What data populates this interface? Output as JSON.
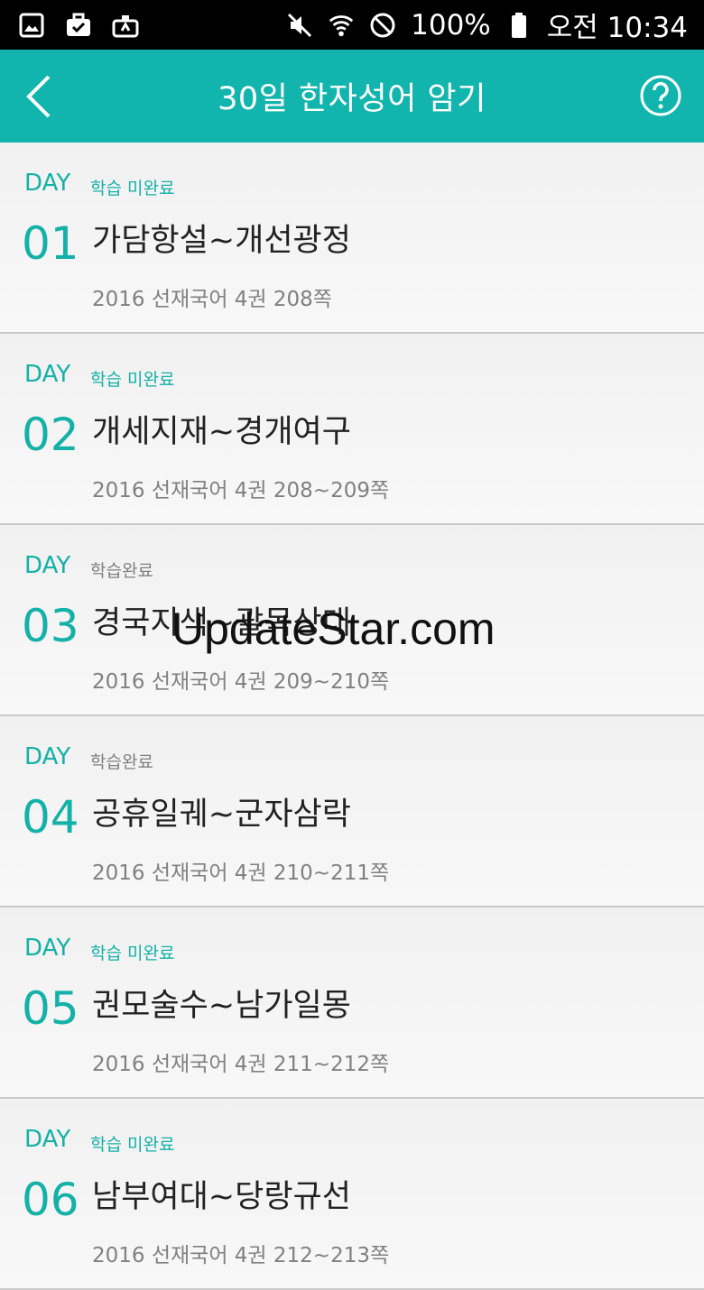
{
  "status_bar": {
    "battery": "100%",
    "time": "오전 10:34",
    "icons": [
      "gallery-icon",
      "briefcase-check-icon",
      "briefcase-share-icon",
      "mute-icon",
      "wifi-icon",
      "no-disturb-icon",
      "battery-icon"
    ]
  },
  "appbar": {
    "title": "30일 한자성어 암기",
    "back_icon": "chevron-left-icon",
    "help_icon": "question-circle-icon"
  },
  "days": [
    {
      "day_label": "DAY",
      "status": "학습 미완료",
      "completed": false,
      "number": "01",
      "title": "가담항설~개선광정",
      "subtitle": "2016 선재국어 4권 208쪽"
    },
    {
      "day_label": "DAY",
      "status": "학습 미완료",
      "completed": false,
      "number": "02",
      "title": "개세지재~경개여구",
      "subtitle": "2016 선재국어 4권 208~209쪽"
    },
    {
      "day_label": "DAY",
      "status": "학습완료",
      "completed": true,
      "number": "03",
      "title": "경국지색~괄목상대",
      "subtitle": "2016 선재국어 4권 209~210쪽"
    },
    {
      "day_label": "DAY",
      "status": "학습완료",
      "completed": true,
      "number": "04",
      "title": "공휴일궤~군자삼락",
      "subtitle": "2016 선재국어 4권 210~211쪽"
    },
    {
      "day_label": "DAY",
      "status": "학습 미완료",
      "completed": false,
      "number": "05",
      "title": "권모술수~남가일몽",
      "subtitle": "2016 선재국어 4권 211~212쪽"
    },
    {
      "day_label": "DAY",
      "status": "학습 미완료",
      "completed": false,
      "number": "06",
      "title": "남부여대~당랑규선",
      "subtitle": "2016 선재국어 4권 212~213쪽"
    }
  ],
  "watermark": "UpdateStar.com",
  "colors": {
    "accent": "#12b5ad",
    "text": "#222222",
    "muted": "#808080"
  }
}
